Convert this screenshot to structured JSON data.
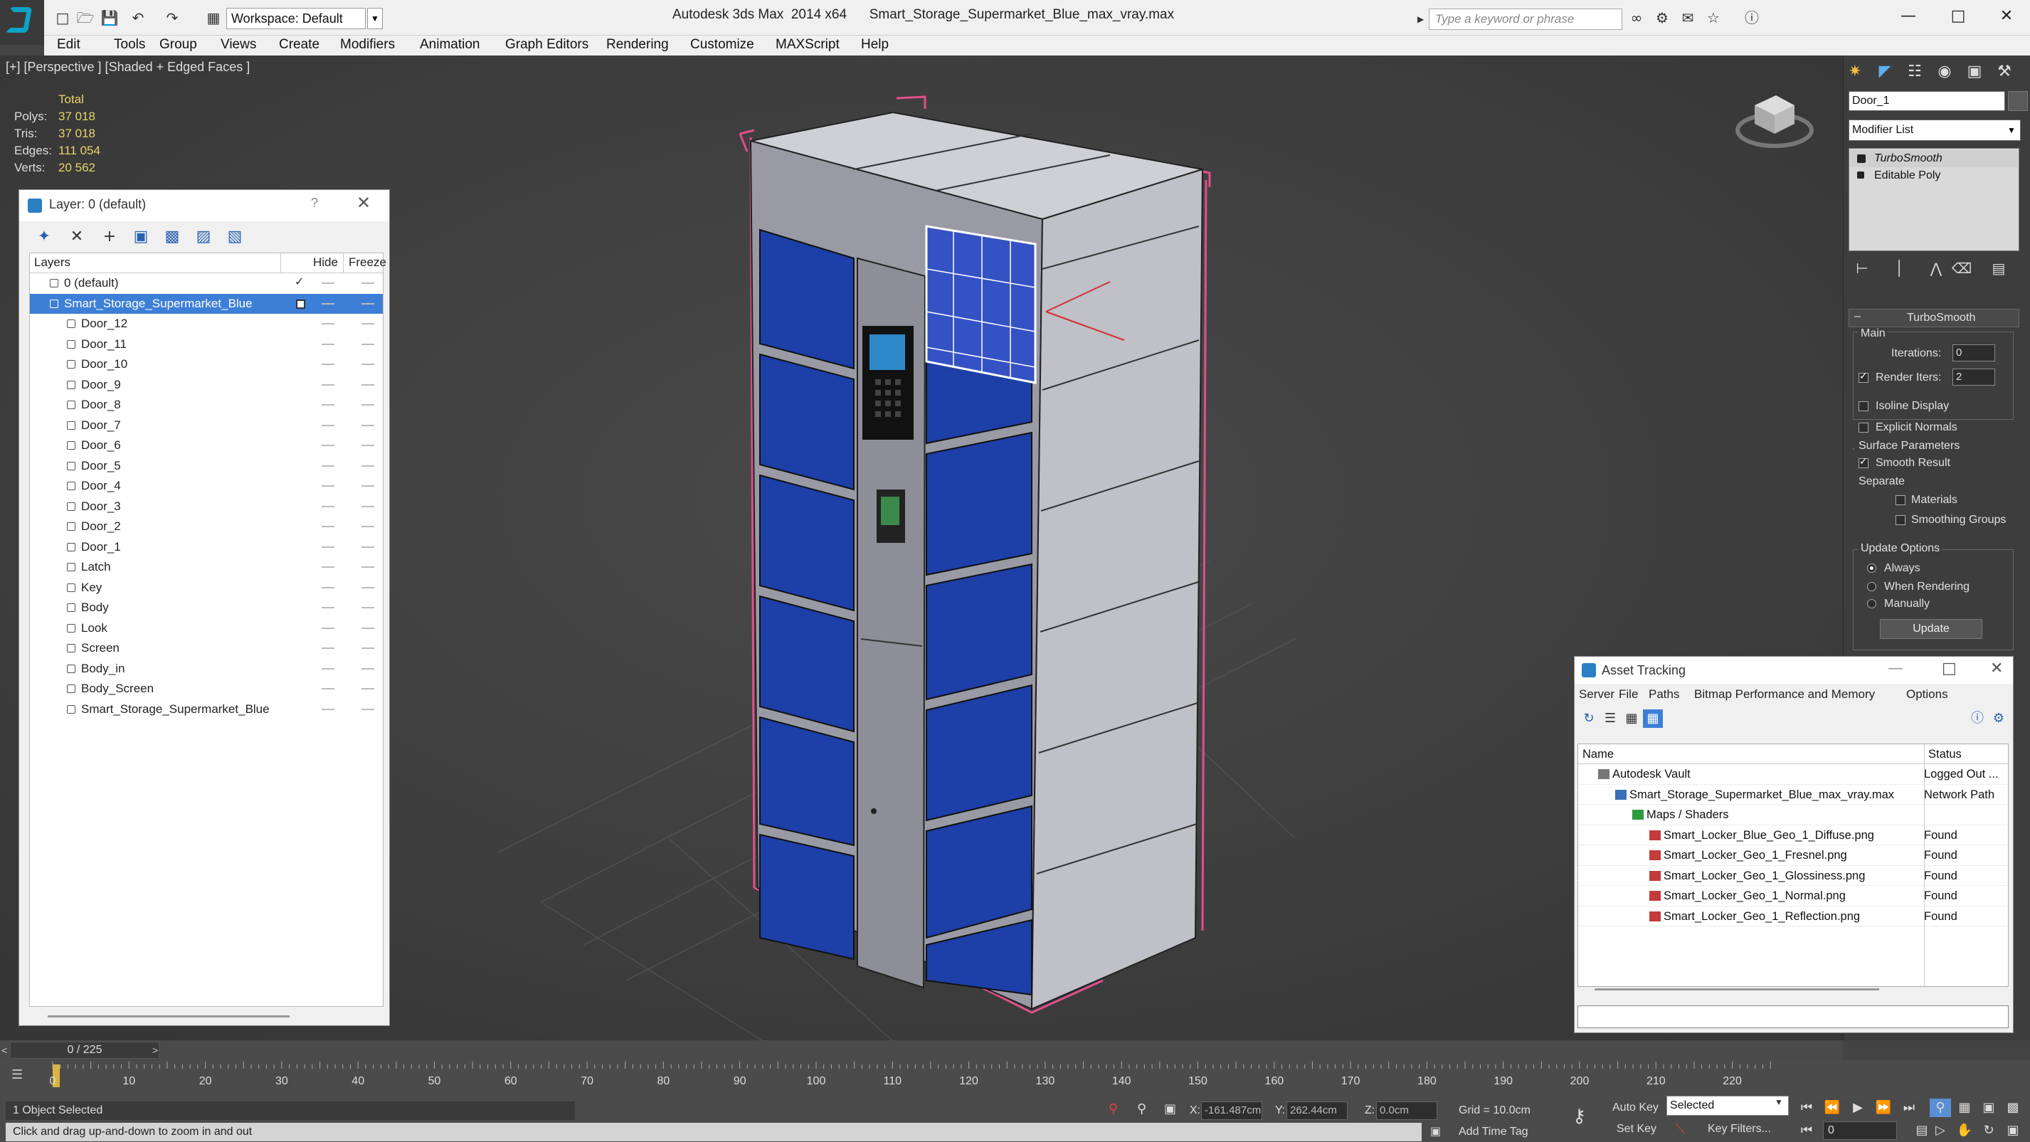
{
  "app": {
    "title": "Autodesk 3ds Max  2014 x64      Smart_Storage_Supermarket_Blue_max_vray.max",
    "workspace": "Workspace: Default",
    "search_placeholder": "Type a keyword or phrase"
  },
  "menu": [
    "Edit",
    "Tools",
    "Group",
    "Views",
    "Create",
    "Modifiers",
    "Animation",
    "Graph Editors",
    "Rendering",
    "Customize",
    "MAXScript",
    "Help"
  ],
  "viewport": {
    "label": "[+] [Perspective ] [Shaded + Edged Faces ]",
    "stats": {
      "header": "Total",
      "polys_label": "Polys:",
      "polys": "37 018",
      "tris_label": "Tris:",
      "tris": "37 018",
      "edges_label": "Edges:",
      "edges": "111 054",
      "verts_label": "Verts:",
      "verts": "20 562"
    }
  },
  "layer_panel": {
    "title": "Layer: 0 (default)",
    "help": "?",
    "col_layers": "Layers",
    "col_hide": "Hide",
    "col_freeze": "Freeze",
    "rows": [
      {
        "name": "0 (default)",
        "level": 0
      },
      {
        "name": "Smart_Storage_Supermarket_Blue",
        "level": 0,
        "selected": true
      },
      {
        "name": "Door_12",
        "level": 1
      },
      {
        "name": "Door_11",
        "level": 1
      },
      {
        "name": "Door_10",
        "level": 1
      },
      {
        "name": "Door_9",
        "level": 1
      },
      {
        "name": "Door_8",
        "level": 1
      },
      {
        "name": "Door_7",
        "level": 1
      },
      {
        "name": "Door_6",
        "level": 1
      },
      {
        "name": "Door_5",
        "level": 1
      },
      {
        "name": "Door_4",
        "level": 1
      },
      {
        "name": "Door_3",
        "level": 1
      },
      {
        "name": "Door_2",
        "level": 1
      },
      {
        "name": "Door_1",
        "level": 1
      },
      {
        "name": "Latch",
        "level": 1
      },
      {
        "name": "Key",
        "level": 1
      },
      {
        "name": "Body",
        "level": 1
      },
      {
        "name": "Look",
        "level": 1
      },
      {
        "name": "Screen",
        "level": 1
      },
      {
        "name": "Body_in",
        "level": 1
      },
      {
        "name": "Body_Screen",
        "level": 1
      },
      {
        "name": "Smart_Storage_Supermarket_Blue",
        "level": 1
      }
    ]
  },
  "command_panel": {
    "object_name": "Door_1",
    "modifier_list": "Modifier List",
    "stack": [
      "TurboSmooth",
      "Editable Poly"
    ],
    "turbosmooth": {
      "title": "TurboSmooth",
      "main": "Main",
      "iterations_label": "Iterations:",
      "iterations": "0",
      "render_iters_label": "Render Iters:",
      "render_iters": "2",
      "render_iters_checked": true,
      "isoline": "Isoline Display",
      "explicit_normals": "Explicit Normals",
      "surface_params": "Surface Parameters",
      "smooth_result": "Smooth Result",
      "separate": "Separate",
      "materials": "Materials",
      "smoothing_groups": "Smoothing Groups",
      "update_options": "Update Options",
      "always": "Always",
      "when_rendering": "When Rendering",
      "manually": "Manually",
      "update_btn": "Update"
    }
  },
  "asset_tracking": {
    "title": "Asset Tracking",
    "menu": [
      "Server",
      "File",
      "Paths",
      "Bitmap Performance and Memory",
      "Options"
    ],
    "col_name": "Name",
    "col_status": "Status",
    "rows": [
      {
        "name": "Autodesk Vault",
        "status": "Logged Out ...",
        "level": 1,
        "icon": "vault"
      },
      {
        "name": "Smart_Storage_Supermarket_Blue_max_vray.max",
        "status": "Network Path",
        "level": 2,
        "icon": "file"
      },
      {
        "name": "Maps / Shaders",
        "status": "",
        "level": 3,
        "icon": "maps"
      },
      {
        "name": "Smart_Locker_Blue_Geo_1_Diffuse.png",
        "status": "Found",
        "level": 4,
        "icon": "png"
      },
      {
        "name": "Smart_Locker_Geo_1_Fresnel.png",
        "status": "Found",
        "level": 4,
        "icon": "png"
      },
      {
        "name": "Smart_Locker_Geo_1_Glossiness.png",
        "status": "Found",
        "level": 4,
        "icon": "png"
      },
      {
        "name": "Smart_Locker_Geo_1_Normal.png",
        "status": "Found",
        "level": 4,
        "icon": "png"
      },
      {
        "name": "Smart_Locker_Geo_1_Reflection.png",
        "status": "Found",
        "level": 4,
        "icon": "png"
      }
    ]
  },
  "timeline": {
    "position": "0 / 225",
    "ticks": [
      "0",
      "10",
      "20",
      "30",
      "40",
      "50",
      "60",
      "70",
      "80",
      "90",
      "100",
      "110",
      "120",
      "130",
      "140",
      "150",
      "160",
      "170",
      "180",
      "190",
      "200",
      "210",
      "220"
    ]
  },
  "status": {
    "selection": "1 Object Selected",
    "prompt": "Click and drag up-and-down to zoom in and out",
    "x_label": "X:",
    "x": "-161.487cm",
    "y_label": "Y:",
    "y": "262.44cm",
    "z_label": "Z:",
    "z": "0.0cm",
    "grid": "Grid = 10.0cm",
    "add_time_tag": "Add Time Tag",
    "auto_key": "Auto Key",
    "set_key": "Set Key",
    "selected": "Selected",
    "key_filters": "Key Filters...",
    "frame": "0"
  },
  "colors": {
    "accent": "#3d7fd6",
    "locker_blue": "#1c3fa8",
    "selection_box": "#e0508a",
    "stats_yellow": "#e8d36a"
  }
}
